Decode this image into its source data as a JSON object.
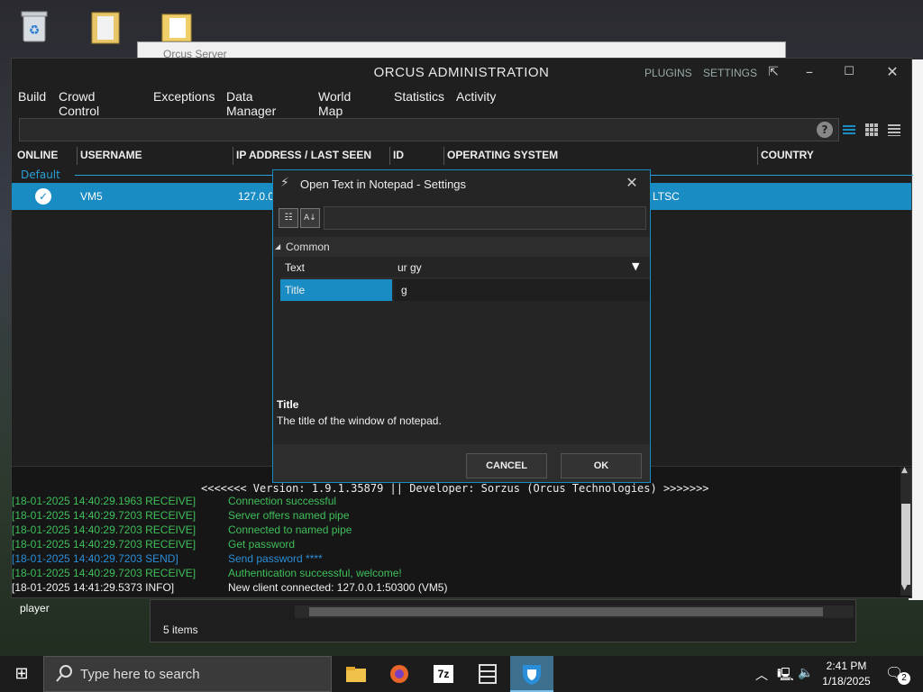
{
  "desktop": {
    "player_label": "player"
  },
  "background_window": {
    "title": "Orcus Server",
    "status": "5 items"
  },
  "app": {
    "title": "ORCUS ADMINISTRATION",
    "links": [
      "PLUGINS",
      "SETTINGS"
    ],
    "menu": [
      "Build",
      "Crowd Control",
      "Exceptions",
      "Data Manager",
      "World Map",
      "Statistics",
      "Activity"
    ],
    "columns": [
      "ONLINE",
      "USERNAME",
      "IP ADDRESS / LAST SEEN",
      "ID",
      "OPERATING SYSTEM",
      "COUNTRY"
    ],
    "group": "Default",
    "row": {
      "username": "VM5",
      "ip": "127.0.0.",
      "os": "LTSC"
    },
    "console": {
      "banner": "<<<<<<< Version: 1.9.1.35879 || Developer: Sorzus (Orcus Technologies) >>>>>>>",
      "logs": [
        {
          "time": "[18-01-2025 14:40:29.1963 RECEIVE]",
          "msg": "Connection successful",
          "color": "#3fbf5a"
        },
        {
          "time": "[18-01-2025 14:40:29.7203 RECEIVE]",
          "msg": "Server offers named pipe",
          "color": "#3fbf5a"
        },
        {
          "time": "[18-01-2025 14:40:29.7203 RECEIVE]",
          "msg": "Connected to named pipe",
          "color": "#3fbf5a"
        },
        {
          "time": "[18-01-2025 14:40:29.7203 RECEIVE]",
          "msg": "Get password",
          "color": "#3fbf5a"
        },
        {
          "time": "[18-01-2025 14:40:29.7203 SEND]",
          "msg": "Send password ****",
          "color": "#2a8fd8"
        },
        {
          "time": "[18-01-2025 14:40:29.7203 RECEIVE]",
          "msg": "Authentication successful, welcome!",
          "color": "#3fbf5a"
        },
        {
          "time": "[18-01-2025 14:41:29.5373 INFO]",
          "msg": "New client connected: 127.0.0.1:50300 (VM5)",
          "color": "#f0f0f0"
        }
      ]
    }
  },
  "dialog": {
    "title": "Open Text in Notepad - Settings",
    "category": "Common",
    "properties": [
      {
        "name": "Text",
        "value": "ur gy"
      },
      {
        "name": "Title",
        "value": "g"
      }
    ],
    "description_title": "Title",
    "description_text": "The title of the window of notepad.",
    "cancel_label": "CANCEL",
    "ok_label": "OK"
  },
  "taskbar": {
    "search_placeholder": "Type here to search",
    "time": "2:41 PM",
    "date": "1/18/2025",
    "notification_count": "2",
    "seven_zip_label": "7z"
  },
  "colors": {
    "accent": "#1a8cc4",
    "log_green": "#3fbf5a",
    "log_blue": "#2a8fd8"
  }
}
